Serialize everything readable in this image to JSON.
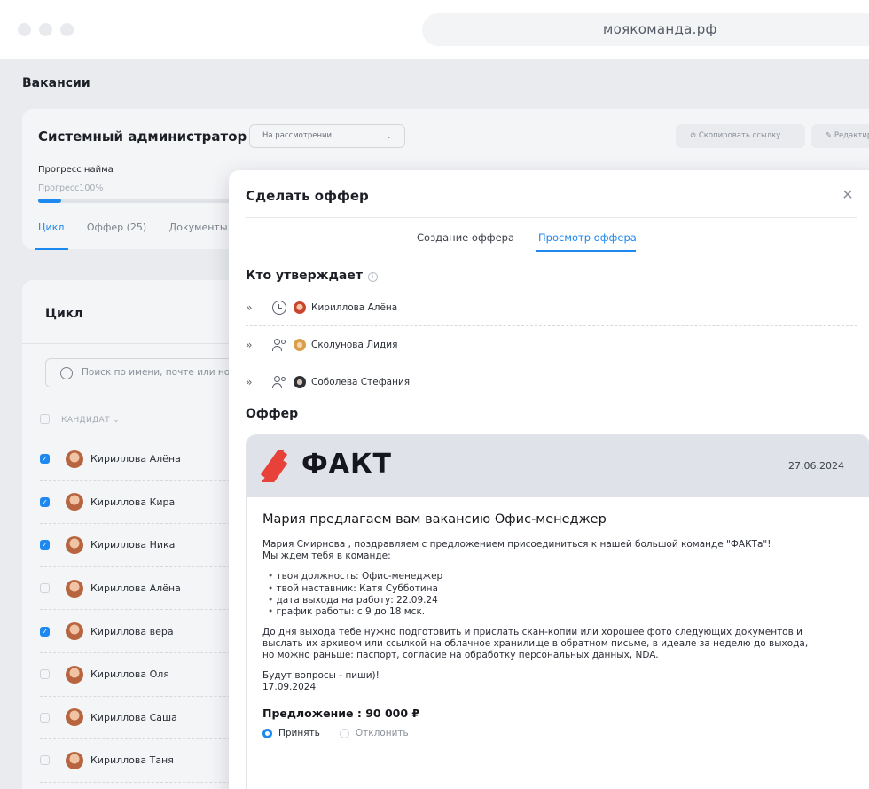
{
  "browser": {
    "url": "моякоманда.рф"
  },
  "page": {
    "title": "Вакансии"
  },
  "vacancy": {
    "title": "Системный администратор",
    "status": "На рассмотрении",
    "copy_link_label": "Скопировать ссылку",
    "edit_label": "Редактировать",
    "progress_label": "Прогресс найма",
    "progress_text": "Прогресс100%",
    "progress_fraction": 0.1,
    "tabs": [
      {
        "label": "Цикл",
        "active": true
      },
      {
        "label": "Оффер (25)",
        "active": false
      },
      {
        "label": "Документы",
        "active": false
      }
    ]
  },
  "cycle": {
    "title": "Цикл",
    "search_placeholder": "Поиск по имени, почте или но",
    "column_candidate": "КАНДИДАТ",
    "candidates": [
      {
        "name": "Кириллова Алёна",
        "checked": true
      },
      {
        "name": "Кириллова Кира",
        "checked": true
      },
      {
        "name": "Кириллова Ника",
        "checked": true
      },
      {
        "name": "Кириллова Алёна",
        "checked": false
      },
      {
        "name": "Кириллова вера",
        "checked": true
      },
      {
        "name": "Кириллова Оля",
        "checked": false
      },
      {
        "name": "Кириллова Саша",
        "checked": false
      },
      {
        "name": "Кириллова Таня",
        "checked": false
      }
    ]
  },
  "modal": {
    "title": "Сделать оффер",
    "tabs": [
      {
        "label": "Создание оффера",
        "active": false
      },
      {
        "label": "Просмотр оффера",
        "active": true
      }
    ],
    "approvers_title": "Кто утверждает",
    "approvers": [
      {
        "name": "Кириллова Алёна",
        "icon": "clock-icon",
        "avatar": "av-red"
      },
      {
        "name": "Сколунова Лидия",
        "icon": "users-icon",
        "avatar": "av-blonde"
      },
      {
        "name": "Соболева Стефания",
        "icon": "users-icon",
        "avatar": "av-dark"
      }
    ],
    "offer_title": "Оффер",
    "offer": {
      "logo_text": "ФАКТ",
      "date": "27.06.2024",
      "headline": "Мария предлагаем вам вакансию Офис-менеджер",
      "intro_1": "Мария Смирнова , поздравляем с предложением присоединиться к нашей большой команде \"ФАКТа\"!",
      "intro_2": "Мы ждем тебя в команде:",
      "bullets": [
        "твоя должность: Офис-менеджер",
        "твой наставник: Катя Субботина",
        "дата выхода на работу: 22.09.24",
        "график работы: с 9 до 18 мск."
      ],
      "docs_1": "До дня выхода тебе нужно подготовить и прислать скан-копии или хорошее фото следующих документов и",
      "docs_2": "выслать их архивом или ссылкой на облачное хранилище в обратном письме, в идеале за неделю до выхода,",
      "docs_3": "но можно раньше:  паспорт, согласие на обработку персональных данных, NDA.",
      "questions": "Будут вопросы - пиши)!",
      "sign_date": "17.09.2024",
      "price": "Предложение : 90 000 ₽",
      "accept_label": "Принять",
      "decline_label": "Отклонить"
    }
  },
  "colors": {
    "accent": "#1d88ef",
    "logo_red": "#e8413a"
  }
}
